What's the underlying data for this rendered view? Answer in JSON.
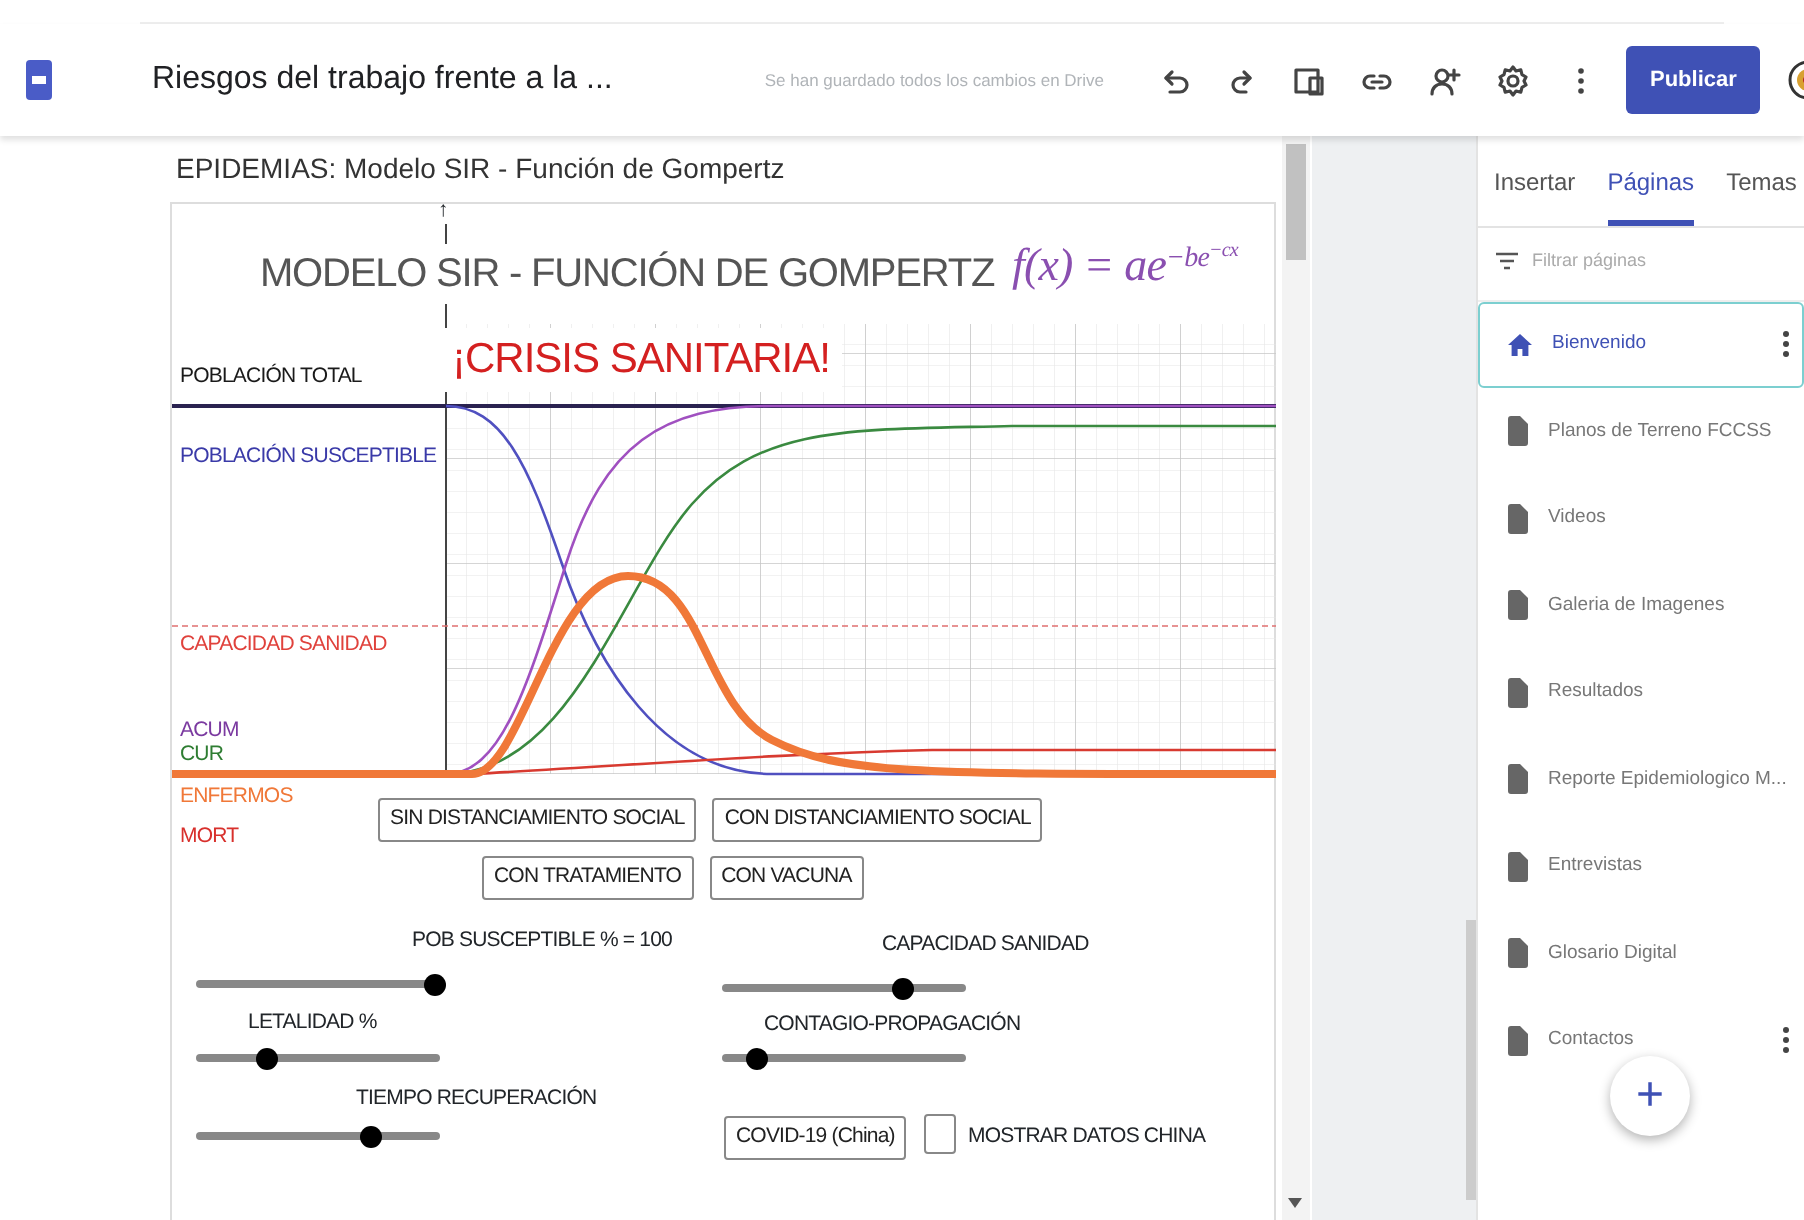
{
  "app_bar": {
    "title": "Riesgos del trabajo frente a la ...",
    "save_status": "Se han guardado todos los cambios en Drive",
    "publish_button": "Publicar"
  },
  "page_heading": "EPIDEMIAS: Modelo SIR - Función de Gompertz",
  "applet": {
    "title": "MODELO SIR - FUNCIÓN DE GOMPERTZ",
    "formula": {
      "base": "f(x) = ae",
      "exponent": "−be",
      "inner_exponent": "−cx"
    },
    "axis_arrow": "↑",
    "alert": "¡CRISIS SANITARIA!",
    "legend": [
      {
        "label": "POBLACIÓN TOTAL",
        "color": "#1a1a1a"
      },
      {
        "label": "POBLACIÓN SUSCEPTIBLE",
        "color": "#3a3aa8"
      },
      {
        "label": "CAPACIDAD SANIDAD",
        "color": "#e0423c"
      },
      {
        "label": "ACUM",
        "color": "#7b3aa0"
      },
      {
        "label": "CUR",
        "color": "#2e7d32"
      },
      {
        "label": "ENFERMOS",
        "color": "#f07838"
      },
      {
        "label": "MORT",
        "color": "#d8302c"
      }
    ],
    "button_rows": [
      {
        "buttons": [
          "SIN DISTANCIAMIENTO SOCIAL",
          "CON DISTANCIAMIENTO SOCIAL"
        ]
      },
      {
        "buttons": [
          "CON TRATAMIENTO",
          "CON VACUNA"
        ]
      }
    ],
    "sliders": [
      {
        "label": "POB SUSCEPTIBLE % = 100",
        "level": 0.98
      },
      {
        "label": "LETALIDAD %",
        "level": 0.29
      },
      {
        "label": "TIEMPO RECUPERACIÓN",
        "level": 0.72
      },
      {
        "label": "CAPACIDAD SANIDAD",
        "level": 0.74
      },
      {
        "label": "CONTAGIO-PROPAGACIÓN",
        "level": 0.14
      }
    ],
    "dataset_button": "COVID-19 (China)",
    "show_data": {
      "label": "MOSTRAR DATOS CHINA",
      "checked": false
    }
  },
  "sidebar": {
    "tabs": [
      {
        "label": "Insertar",
        "selected": false
      },
      {
        "label": "Páginas",
        "selected": true
      },
      {
        "label": "Temas",
        "selected": false
      }
    ],
    "filter": {
      "placeholder": "Filtrar páginas"
    },
    "pages": [
      {
        "label": "Bienvenido",
        "kind": "home",
        "selected": true,
        "menu": true
      },
      {
        "label": "Planos de Terreno FCCSS",
        "kind": "page",
        "selected": false,
        "menu": false
      },
      {
        "label": "Videos",
        "kind": "page",
        "selected": false,
        "menu": false
      },
      {
        "label": "Galeria de Imagenes",
        "kind": "page",
        "selected": false,
        "menu": false
      },
      {
        "label": "Resultados",
        "kind": "page",
        "selected": false,
        "menu": false
      },
      {
        "label": "Reporte Epidemiologico M...",
        "kind": "page",
        "selected": false,
        "menu": false
      },
      {
        "label": "Entrevistas",
        "kind": "page",
        "selected": false,
        "menu": false
      },
      {
        "label": "Glosario Digital",
        "kind": "page",
        "selected": false,
        "menu": false
      },
      {
        "label": "Contactos",
        "kind": "page",
        "selected": false,
        "menu": true
      }
    ],
    "fab": "+"
  }
}
